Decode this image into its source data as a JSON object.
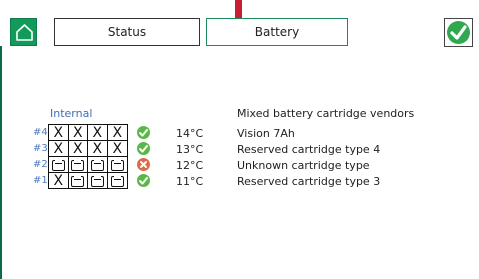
{
  "header": {
    "home_icon": "home-icon",
    "tabs": [
      {
        "label": "Status"
      },
      {
        "label": "Battery"
      }
    ],
    "confirm_icon": "check-icon"
  },
  "battery": {
    "group_label": "Internal",
    "vendor_note": "Mixed battery cartridge vendors",
    "rows": [
      {
        "slot": "#4",
        "cells": [
          "X",
          "X",
          "X",
          "X"
        ],
        "status": "ok",
        "temp": "14°C",
        "desc": "Vision 7Ah"
      },
      {
        "slot": "#3",
        "cells": [
          "X",
          "X",
          "X",
          "X"
        ],
        "status": "ok",
        "temp": "13°C",
        "desc": "Reserved cartridge type 4"
      },
      {
        "slot": "#2",
        "cells": [
          "",
          "",
          "",
          ""
        ],
        "status": "error",
        "temp": "12°C",
        "desc": "Unknown cartridge type"
      },
      {
        "slot": "#1",
        "cells": [
          "X",
          "",
          "",
          ""
        ],
        "status": "ok",
        "temp": "11°C",
        "desc": "Reserved cartridge type 3"
      }
    ]
  },
  "colors": {
    "ok": "#59b847",
    "error": "#e06a43",
    "accent": "#129a5a"
  }
}
